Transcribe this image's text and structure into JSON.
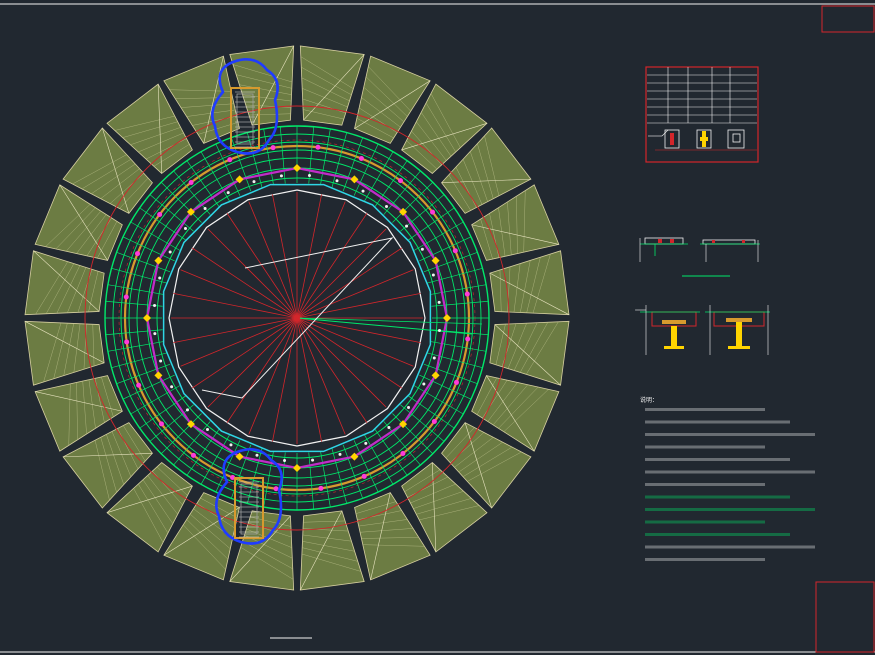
{
  "drawing": {
    "title_block_top": "",
    "title_block_bottom": "",
    "plan_label": "",
    "notes_heading": "说明：",
    "notes_lines": [
      "",
      "",
      "",
      "",
      "",
      "",
      "",
      "",
      "",
      "",
      "",
      "",
      ""
    ]
  },
  "colors": {
    "background": "#212830",
    "red": "#d3262b",
    "green": "#00e86a",
    "yellow": "#ffd400",
    "magenta": "#c12cc8",
    "cyan": "#2fd6e6",
    "orange": "#d79a2e",
    "white": "#f2f2f2",
    "hatch": "#6c7c43",
    "blue": "#1f3cff"
  }
}
